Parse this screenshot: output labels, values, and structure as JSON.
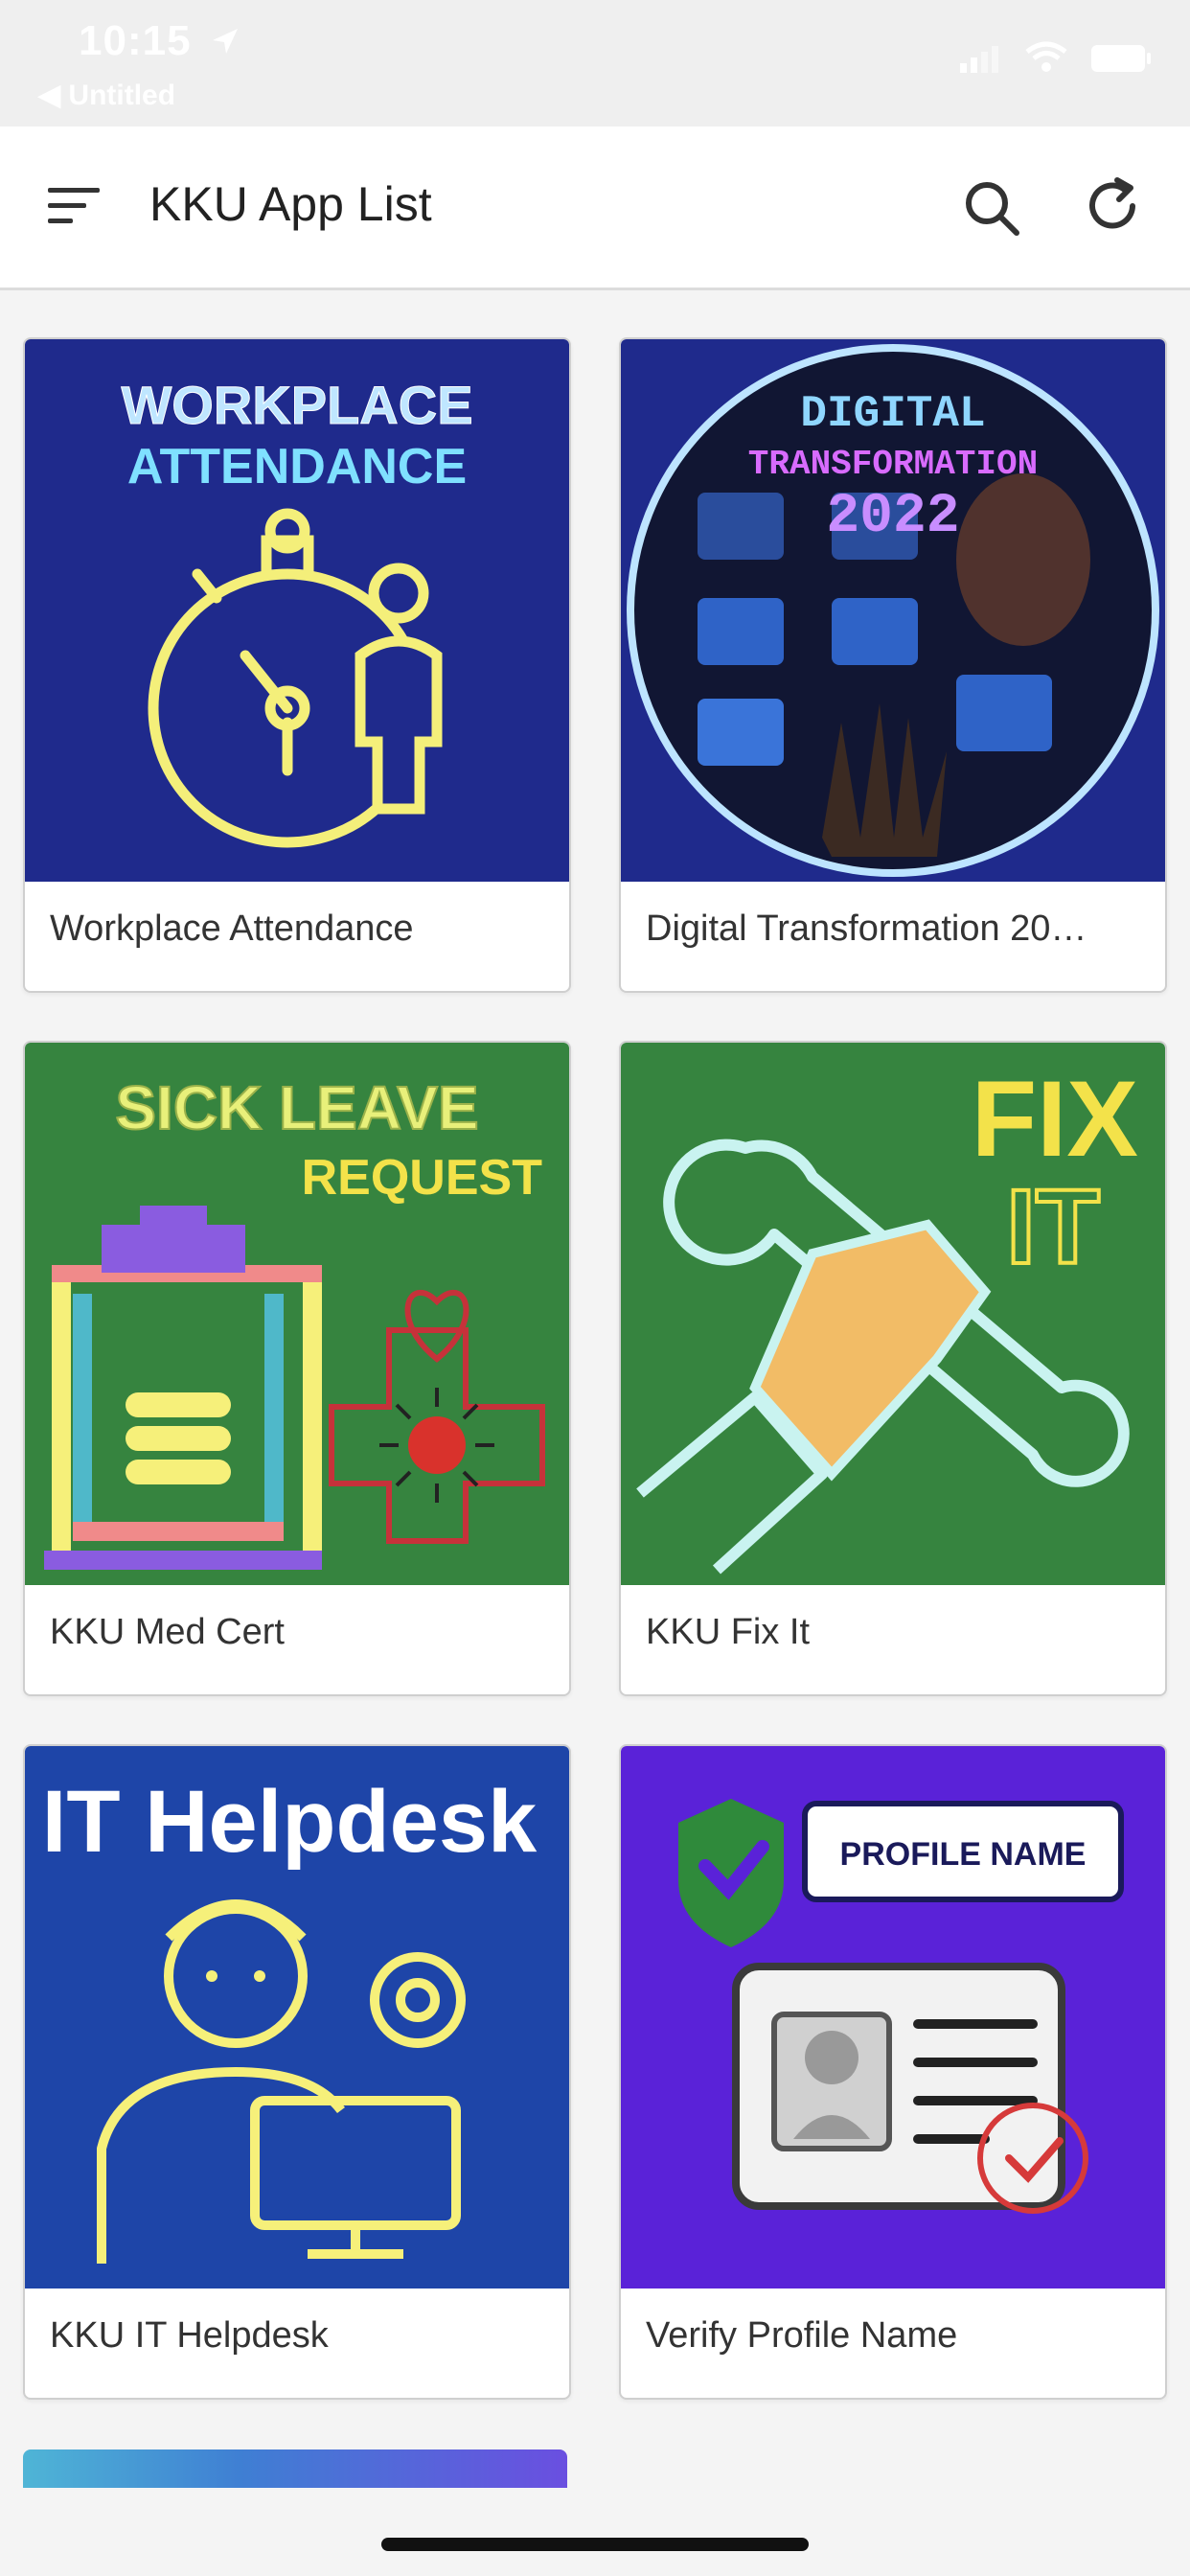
{
  "status_bar": {
    "time": "10:15",
    "back_label": "◀ Untitled"
  },
  "header": {
    "title": "KKU App List"
  },
  "apps": [
    {
      "label": "Workplace Attendance",
      "art_lines": [
        "WORKPLACE",
        "ATTENDANCE"
      ],
      "bg": "#1f2a8c"
    },
    {
      "label": "Digital Transformation 20…",
      "art_lines": [
        "DIGITAL",
        "TRANSFORMATION",
        "2022"
      ],
      "bg": "#1f2a8c"
    },
    {
      "label": "KKU Med Cert",
      "art_lines": [
        "SICK LEAVE",
        "REQUEST"
      ],
      "bg": "#36843f"
    },
    {
      "label": "KKU Fix It",
      "art_lines": [
        "FIX",
        "IT"
      ],
      "bg": "#36843f"
    },
    {
      "label": "KKU IT Helpdesk",
      "art_lines": [
        "IT Helpdesk"
      ],
      "bg": "#1e45a8"
    },
    {
      "label": "Verify Profile Name",
      "art_lines": [
        "PROFILE NAME"
      ],
      "bg": "#5a22d8"
    }
  ]
}
